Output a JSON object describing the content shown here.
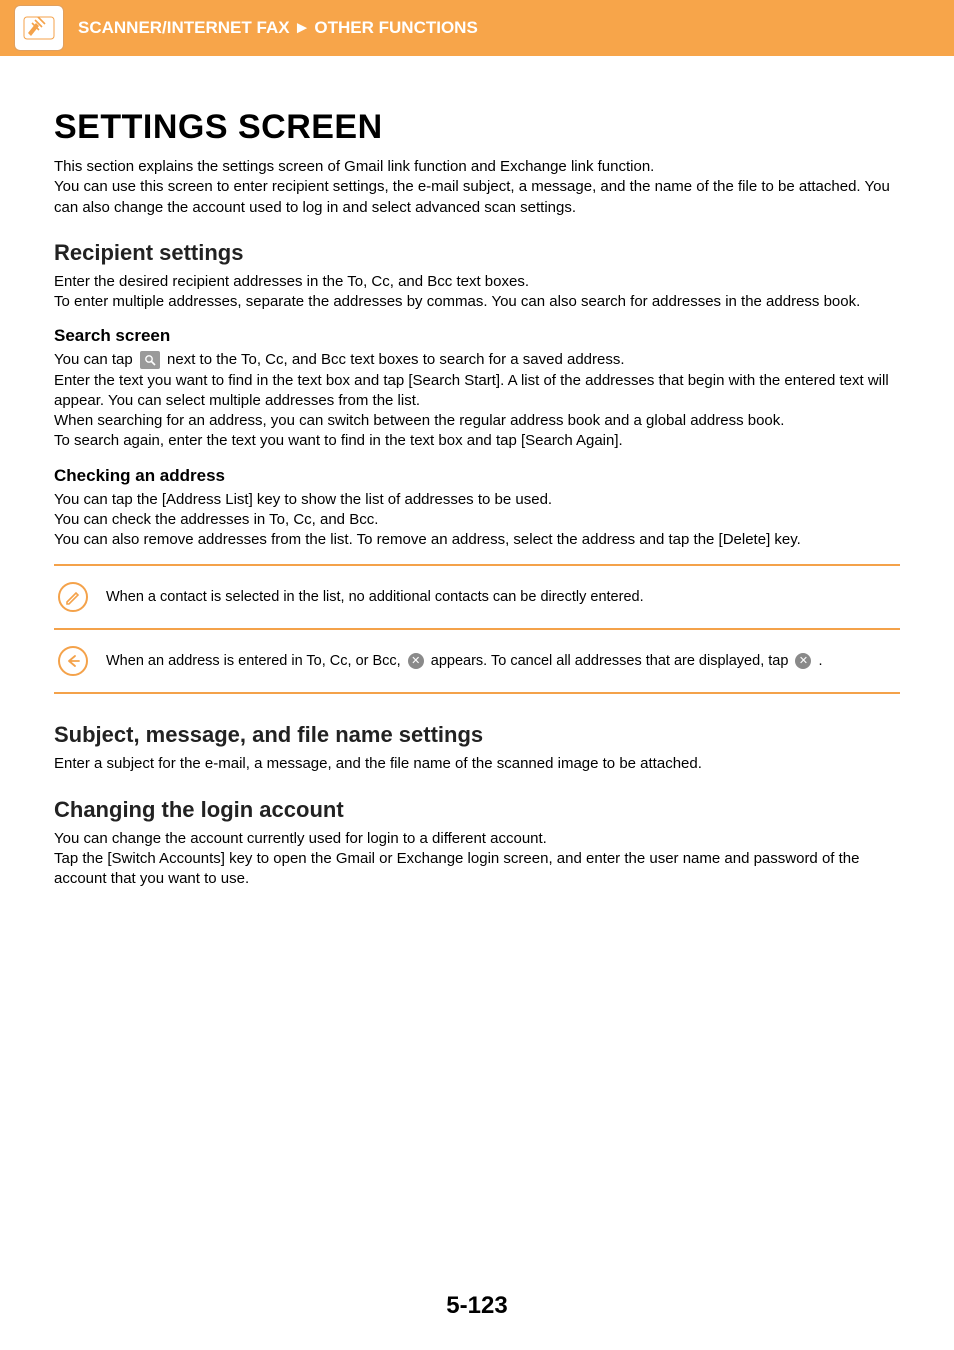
{
  "header": {
    "breadcrumb1": "SCANNER/INTERNET FAX",
    "sep": "►",
    "breadcrumb2": "OTHER FUNCTIONS"
  },
  "title": "SETTINGS SCREEN",
  "intro1": "This section explains the settings screen of Gmail link function and Exchange link function.",
  "intro2": "You can use this screen to enter recipient settings, the e-mail subject, a message, and the name of the file to be attached. You can also change the account used to log in and select advanced scan settings.",
  "recipient": {
    "heading": "Recipient settings",
    "p1": "Enter the desired recipient addresses in the To, Cc, and Bcc text boxes.",
    "p2": "To enter multiple addresses, separate the addresses by commas. You can also search for addresses in the address book.",
    "search": {
      "heading": "Search screen",
      "line1a": "You can tap ",
      "line1b": " next to the To, Cc, and Bcc text boxes to search for a saved address.",
      "line2": "Enter the text you want to find in the text box and tap [Search Start]. A list of the addresses that begin with the entered text will appear. You can select multiple addresses from the list.",
      "line3": "When searching for an address, you can switch between the regular address book and a global address book.",
      "line4": "To search again, enter the text you want to find in the text box and tap [Search Again]."
    },
    "checking": {
      "heading": "Checking an address",
      "line1": "You can tap the [Address List] key to show the list of addresses to be used.",
      "line2": "You can check the addresses in To, Cc, and Bcc.",
      "line3": "You can also remove addresses from the list. To remove an address, select the address and tap the [Delete] key."
    }
  },
  "notes": {
    "note1": "When a contact is selected in the list, no additional contacts can be directly entered.",
    "note2a": "When an address is entered in To, Cc, or Bcc, ",
    "note2b": " appears. To cancel all addresses that are displayed, tap ",
    "note2c": "."
  },
  "subject": {
    "heading": "Subject, message, and file name settings",
    "body": "Enter a subject for the e-mail, a message, and the file name of the scanned image to be attached."
  },
  "login": {
    "heading": "Changing the login account",
    "p1": "You can change the account currently used for login to a different account.",
    "p2": "Tap the [Switch Accounts] key to open the Gmail or Exchange login screen, and enter the user name and password of the account that you want to use."
  },
  "pagenum": "5-123"
}
